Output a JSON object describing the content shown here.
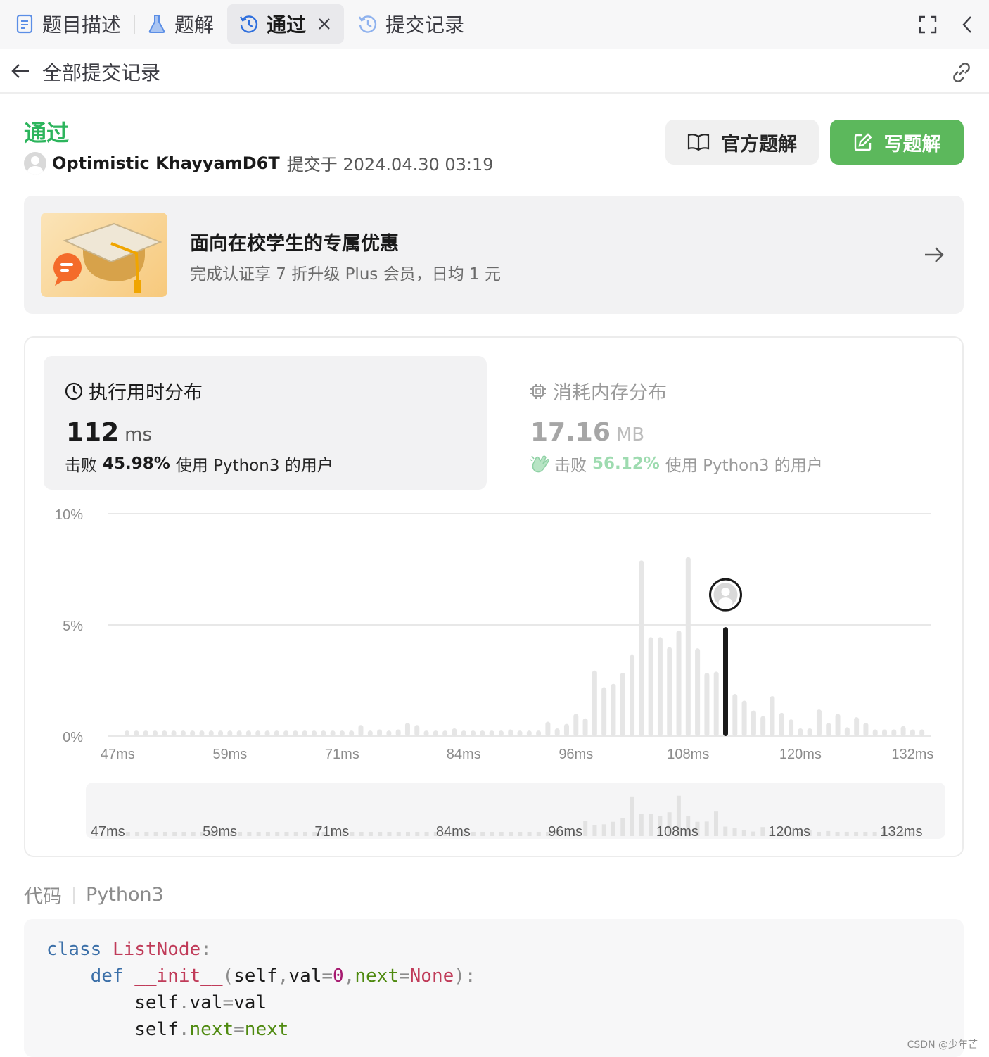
{
  "tabs": [
    {
      "label": "题目描述",
      "icon": "document-icon"
    },
    {
      "label": "题解",
      "icon": "flask-icon"
    },
    {
      "label": "通过",
      "icon": "history-icon",
      "active": true
    },
    {
      "label": "提交记录",
      "icon": "history-icon"
    }
  ],
  "subheader": {
    "title": "全部提交记录"
  },
  "submission": {
    "status": "通过",
    "user": "Optimistic KhayyamD6T",
    "submitted_at": "提交于 2024.04.30 03:19"
  },
  "buttons": {
    "official": "官方题解",
    "write": "写题解"
  },
  "promo": {
    "title": "面向在校学生的专属优惠",
    "desc": "完成认证享 7 折升级 Plus 会员，日均 1 元"
  },
  "runtime": {
    "title": "执行用时分布",
    "value": "112",
    "unit": "ms",
    "beat_prefix": "击败",
    "beat_pct": "45.98%",
    "beat_suffix": "使用 Python3 的用户"
  },
  "memory": {
    "title": "消耗内存分布",
    "value": "17.16",
    "unit": "MB",
    "beat_prefix": "击败",
    "beat_pct": "56.12%",
    "beat_suffix": "使用 Python3 的用户"
  },
  "colors": {
    "accent_green": "#2db55d",
    "button_green": "#5cb85c",
    "highlight_bar": "#1a1a1a"
  },
  "chart_data": {
    "type": "bar",
    "y_ticks": [
      "10%",
      "5%",
      "0%"
    ],
    "ylim": [
      0,
      10
    ],
    "x_ticks": [
      "47ms",
      "59ms",
      "71ms",
      "84ms",
      "96ms",
      "108ms",
      "120ms",
      "132ms"
    ],
    "highlight_ms": 112,
    "x_start": 47,
    "bar_step_ms": 1.2,
    "values": [
      0.25,
      0.25,
      0.25,
      0.25,
      0.25,
      0.25,
      0.25,
      0.25,
      0.25,
      0.25,
      0.25,
      0.25,
      0.25,
      0.25,
      0.25,
      0.25,
      0.25,
      0.25,
      0.25,
      0.25,
      0.25,
      0.25,
      0.25,
      0.25,
      0.25,
      0.25,
      0.25,
      0.25,
      0.25,
      0.25,
      0.25,
      0.25,
      0.25,
      0.25,
      0.25,
      0.25,
      0.25,
      0.25,
      0.25,
      0.25,
      0.25,
      0.25,
      0.25,
      0.25,
      0.25,
      0.25,
      0.25,
      0.25,
      0.25,
      0.25,
      0.25,
      0.25,
      0.25,
      0.25,
      0.25,
      0.25,
      0.25,
      0.25,
      0.25,
      0.25,
      0.25,
      0.25,
      0.25,
      0.25,
      0.25,
      0.25,
      0.25,
      0.25,
      0.25,
      0.25,
      0.25,
      0.25,
      0.25,
      0.25,
      0.25,
      0.25,
      0.25,
      0.25,
      0.25,
      0.25,
      0.25,
      0.25,
      0.25,
      0.25,
      0.25,
      0.25,
      0.25,
      0.25,
      0.25,
      0.25,
      0.25,
      0.25,
      0.25,
      0.25,
      0.25,
      0.25,
      0.25,
      0.25,
      0.25,
      0.25,
      0.25,
      0.25,
      0.25,
      0.25,
      0.25,
      0.25,
      0.25,
      0.25,
      0.25,
      0.25,
      0.25,
      0.25,
      0.25,
      0.25,
      0.25,
      0.25,
      0.25,
      0.25,
      0.25
    ],
    "bars": [
      {
        "ms": 48,
        "v": 0.25
      },
      {
        "ms": 49,
        "v": 0.25
      },
      {
        "ms": 50,
        "v": 0.25
      },
      {
        "ms": 51,
        "v": 0.25
      },
      {
        "ms": 52,
        "v": 0.25
      },
      {
        "ms": 53,
        "v": 0.25
      },
      {
        "ms": 54,
        "v": 0.25
      },
      {
        "ms": 55,
        "v": 0.25
      },
      {
        "ms": 56,
        "v": 0.25
      },
      {
        "ms": 57,
        "v": 0.25
      },
      {
        "ms": 58,
        "v": 0.25
      },
      {
        "ms": 59,
        "v": 0.25
      },
      {
        "ms": 60,
        "v": 0.25
      },
      {
        "ms": 61,
        "v": 0.25
      },
      {
        "ms": 62,
        "v": 0.25
      },
      {
        "ms": 63,
        "v": 0.25
      },
      {
        "ms": 64,
        "v": 0.25
      },
      {
        "ms": 65,
        "v": 0.25
      },
      {
        "ms": 66,
        "v": 0.25
      },
      {
        "ms": 67,
        "v": 0.25
      },
      {
        "ms": 68,
        "v": 0.25
      },
      {
        "ms": 69,
        "v": 0.25
      },
      {
        "ms": 70,
        "v": 0.25
      },
      {
        "ms": 71,
        "v": 0.25
      },
      {
        "ms": 72,
        "v": 0.25
      },
      {
        "ms": 73,
        "v": 0.5
      },
      {
        "ms": 74,
        "v": 0.25
      },
      {
        "ms": 75,
        "v": 0.3
      },
      {
        "ms": 76,
        "v": 0.25
      },
      {
        "ms": 77,
        "v": 0.3
      },
      {
        "ms": 78,
        "v": 0.6
      },
      {
        "ms": 79,
        "v": 0.5
      },
      {
        "ms": 80,
        "v": 0.25
      },
      {
        "ms": 81,
        "v": 0.25
      },
      {
        "ms": 82,
        "v": 0.25
      },
      {
        "ms": 83,
        "v": 0.35
      },
      {
        "ms": 84,
        "v": 0.25
      },
      {
        "ms": 85,
        "v": 0.25
      },
      {
        "ms": 86,
        "v": 0.25
      },
      {
        "ms": 87,
        "v": 0.25
      },
      {
        "ms": 88,
        "v": 0.25
      },
      {
        "ms": 89,
        "v": 0.3
      },
      {
        "ms": 90,
        "v": 0.25
      },
      {
        "ms": 91,
        "v": 0.25
      },
      {
        "ms": 92,
        "v": 0.25
      },
      {
        "ms": 93,
        "v": 0.65
      },
      {
        "ms": 94,
        "v": 0.35
      },
      {
        "ms": 95,
        "v": 0.55
      },
      {
        "ms": 96,
        "v": 1.0
      },
      {
        "ms": 97,
        "v": 0.8
      },
      {
        "ms": 98,
        "v": 2.95
      },
      {
        "ms": 99,
        "v": 2.2
      },
      {
        "ms": 100,
        "v": 2.35
      },
      {
        "ms": 101,
        "v": 2.85
      },
      {
        "ms": 102,
        "v": 3.65
      },
      {
        "ms": 103,
        "v": 7.9
      },
      {
        "ms": 104,
        "v": 4.45
      },
      {
        "ms": 105,
        "v": 4.45
      },
      {
        "ms": 106,
        "v": 4.0
      },
      {
        "ms": 107,
        "v": 4.75
      },
      {
        "ms": 108,
        "v": 8.05
      },
      {
        "ms": 109,
        "v": 3.95
      },
      {
        "ms": 110,
        "v": 2.85
      },
      {
        "ms": 111,
        "v": 2.9
      },
      {
        "ms": 112,
        "v": 4.9
      },
      {
        "ms": 113,
        "v": 1.9
      },
      {
        "ms": 114,
        "v": 1.6
      },
      {
        "ms": 115,
        "v": 1.15
      },
      {
        "ms": 116,
        "v": 0.9
      },
      {
        "ms": 117,
        "v": 1.8
      },
      {
        "ms": 118,
        "v": 1.05
      },
      {
        "ms": 119,
        "v": 0.75
      },
      {
        "ms": 120,
        "v": 0.35
      },
      {
        "ms": 121,
        "v": 0.35
      },
      {
        "ms": 122,
        "v": 1.2
      },
      {
        "ms": 123,
        "v": 0.6
      },
      {
        "ms": 124,
        "v": 1.0
      },
      {
        "ms": 125,
        "v": 0.4
      },
      {
        "ms": 126,
        "v": 0.85
      },
      {
        "ms": 127,
        "v": 0.6
      },
      {
        "ms": 128,
        "v": 0.3
      },
      {
        "ms": 129,
        "v": 0.3
      },
      {
        "ms": 130,
        "v": 0.3
      },
      {
        "ms": 131,
        "v": 0.45
      },
      {
        "ms": 132,
        "v": 0.3
      },
      {
        "ms": 133,
        "v": 0.3
      }
    ]
  },
  "code": {
    "label": "代码",
    "language": "Python3",
    "lines": [
      [
        {
          "t": "class",
          "c": "kw"
        },
        {
          "t": " "
        },
        {
          "t": "ListNode",
          "c": "cls"
        },
        {
          "t": ":",
          "c": "punc"
        }
      ],
      [
        {
          "t": "    "
        },
        {
          "t": "def",
          "c": "kw"
        },
        {
          "t": " "
        },
        {
          "t": "__init__",
          "c": "fn"
        },
        {
          "t": "(",
          "c": "punc"
        },
        {
          "t": "self"
        },
        {
          "t": ",",
          "c": "punc"
        },
        {
          "t": "val"
        },
        {
          "t": "=",
          "c": "punc"
        },
        {
          "t": "0",
          "c": "num"
        },
        {
          "t": ",",
          "c": "punc"
        },
        {
          "t": "next",
          "c": "attr"
        },
        {
          "t": "=",
          "c": "punc"
        },
        {
          "t": "None",
          "c": "none"
        },
        {
          "t": "):",
          "c": "punc"
        }
      ],
      [
        {
          "t": "        "
        },
        {
          "t": "self"
        },
        {
          "t": ".",
          "c": "punc"
        },
        {
          "t": "val"
        },
        {
          "t": "=",
          "c": "punc"
        },
        {
          "t": "val"
        }
      ],
      [
        {
          "t": "        "
        },
        {
          "t": "self"
        },
        {
          "t": ".",
          "c": "punc"
        },
        {
          "t": "next",
          "c": "attr"
        },
        {
          "t": "=",
          "c": "punc"
        },
        {
          "t": "next",
          "c": "attr"
        }
      ]
    ]
  },
  "watermark": "CSDN @少年芒"
}
